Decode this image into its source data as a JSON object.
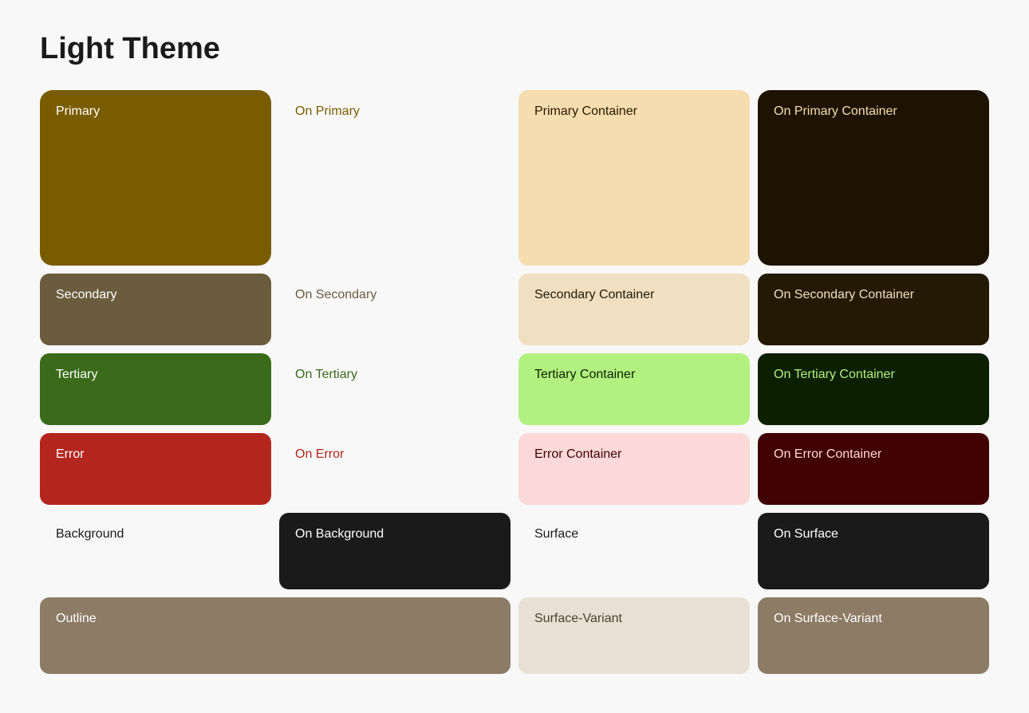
{
  "page": {
    "title": "Light Theme"
  },
  "colors": {
    "rows": [
      {
        "id": "primary-row",
        "cells": [
          {
            "id": "primary",
            "label": "Primary",
            "style": "primary",
            "span": 1,
            "rowspan": 1
          },
          {
            "id": "on-primary",
            "label": "On Primary",
            "style": "on-primary",
            "span": 1
          },
          {
            "id": "primary-container",
            "label": "Primary Container",
            "style": "primary-container",
            "span": 1
          },
          {
            "id": "on-primary-container",
            "label": "On Primary Container",
            "style": "on-primary-container",
            "span": 1
          }
        ]
      },
      {
        "id": "secondary-row",
        "cells": [
          {
            "id": "secondary",
            "label": "Secondary",
            "style": "secondary",
            "span": 1
          },
          {
            "id": "on-secondary",
            "label": "On Secondary",
            "style": "on-secondary",
            "span": 1
          },
          {
            "id": "secondary-container",
            "label": "Secondary Container",
            "style": "secondary-container",
            "span": 1
          },
          {
            "id": "on-secondary-container",
            "label": "On Secondary Container",
            "style": "on-secondary-container",
            "span": 1
          }
        ]
      },
      {
        "id": "tertiary-row",
        "cells": [
          {
            "id": "tertiary",
            "label": "Tertiary",
            "style": "tertiary",
            "span": 1
          },
          {
            "id": "on-tertiary",
            "label": "On Tertiary",
            "style": "on-tertiary",
            "span": 1
          },
          {
            "id": "tertiary-container",
            "label": "Tertiary Container",
            "style": "tertiary-container",
            "span": 1
          },
          {
            "id": "on-tertiary-container",
            "label": "On Tertiary Container",
            "style": "on-tertiary-container",
            "span": 1
          }
        ]
      },
      {
        "id": "error-row",
        "cells": [
          {
            "id": "error",
            "label": "Error",
            "style": "error",
            "span": 1
          },
          {
            "id": "on-error",
            "label": "On Error",
            "style": "on-error",
            "span": 1
          },
          {
            "id": "error-container",
            "label": "Error Container",
            "style": "error-container",
            "span": 1
          },
          {
            "id": "on-error-container",
            "label": "On Error Container",
            "style": "on-error-container",
            "span": 1
          }
        ]
      },
      {
        "id": "background-row",
        "cells": [
          {
            "id": "background",
            "label": "Background",
            "style": "background",
            "span": 1
          },
          {
            "id": "on-background",
            "label": "On Background",
            "style": "on-background",
            "span": 1
          },
          {
            "id": "surface",
            "label": "Surface",
            "style": "surface",
            "span": 1
          },
          {
            "id": "on-surface",
            "label": "On Surface",
            "style": "on-surface",
            "span": 1
          }
        ]
      },
      {
        "id": "outline-row",
        "cells": [
          {
            "id": "outline",
            "label": "Outline",
            "style": "outline",
            "span": 2
          },
          {
            "id": "surface-variant",
            "label": "Surface-Variant",
            "style": "surface-variant",
            "span": 1
          },
          {
            "id": "on-surface-variant",
            "label": "On Surface-Variant",
            "style": "on-surface-variant",
            "span": 1
          }
        ]
      }
    ]
  }
}
